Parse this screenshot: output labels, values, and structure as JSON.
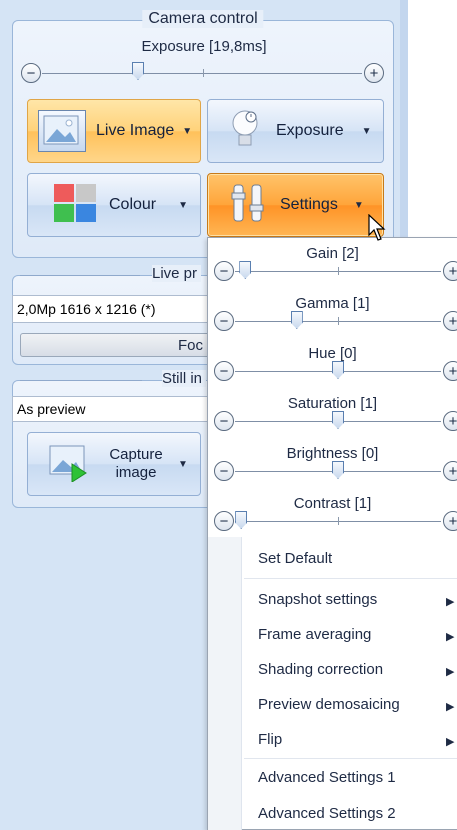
{
  "camera_control": {
    "title": "Camera control",
    "exposure_label": "Exposure [19,8ms]",
    "exposure_level_fraction": 0.3,
    "buttons": {
      "live_image": "Live Image",
      "exposure": "Exposure",
      "colour": "Colour",
      "settings": "Settings"
    }
  },
  "live_preview": {
    "title": "Live pr",
    "resolution": "2,0Mp 1616 x 1216 (*)",
    "focus_button": "Foc"
  },
  "still_image": {
    "title": "Still in",
    "mode": "As preview",
    "capture_button": "Capture image"
  },
  "settings_dropdown": {
    "sliders": [
      {
        "label": "Gain [2]",
        "level": 0.05
      },
      {
        "label": "Gamma [1]",
        "level": 0.3
      },
      {
        "label": "Hue [0]",
        "level": 0.5
      },
      {
        "label": "Saturation [1]",
        "level": 0.5
      },
      {
        "label": "Brightness [0]",
        "level": 0.5
      },
      {
        "label": "Contrast [1]",
        "level": 0.03
      }
    ],
    "menu": {
      "set_default": "Set Default",
      "snapshot_settings": "Snapshot settings",
      "frame_averaging": "Frame averaging",
      "shading_correction": "Shading correction",
      "preview_demosaicing": "Preview demosaicing",
      "flip": "Flip",
      "advanced_settings_1": "Advanced Settings 1",
      "advanced_settings_2": "Advanced Settings 2"
    }
  },
  "colors": {
    "panel": "#d5e4f5",
    "active_button": "#ffa53a",
    "highlight_button": "#ffd27a"
  }
}
